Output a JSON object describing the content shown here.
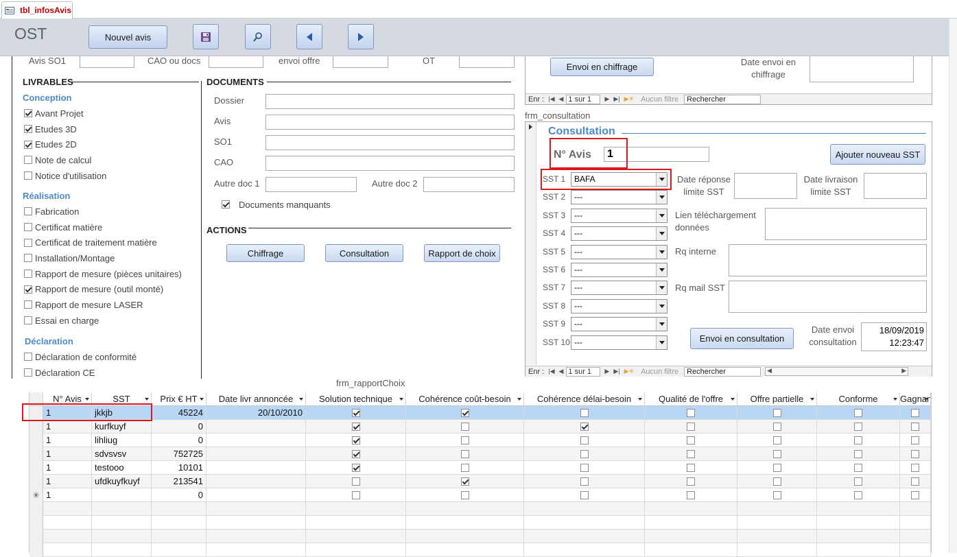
{
  "tab": {
    "label": "tbl_infosAvis"
  },
  "header": {
    "title": "OST",
    "new_button": "Nouvel avis"
  },
  "top_partial": {
    "labels": [
      "Avis SO1",
      "CAO ou docs",
      "envoi offre",
      "OT"
    ]
  },
  "livrables": {
    "title": "LIVRABLES",
    "conception": {
      "title": "Conception",
      "items": [
        {
          "label": "Avant Projet",
          "checked": true
        },
        {
          "label": "Etudes 3D",
          "checked": true
        },
        {
          "label": "Etudes 2D",
          "checked": true
        },
        {
          "label": "Note de calcul",
          "checked": false
        },
        {
          "label": "Notice d'utilisation",
          "checked": false
        }
      ]
    },
    "realisation": {
      "title": "Réalisation",
      "items": [
        {
          "label": "Fabrication",
          "checked": false
        },
        {
          "label": "Certificat matière",
          "checked": false
        },
        {
          "label": "Certificat de traitement matière",
          "checked": false
        },
        {
          "label": "Installation/Montage",
          "checked": false
        },
        {
          "label": "Rapport de mesure (pièces unitaires)",
          "checked": false
        },
        {
          "label": "Rapport de mesure (outil monté)",
          "checked": true
        },
        {
          "label": "Rapport de mesure LASER",
          "checked": false
        },
        {
          "label": "Essai en charge",
          "checked": false
        }
      ]
    },
    "declaration": {
      "title": "Déclaration",
      "items": [
        {
          "label": "Déclaration de conformité",
          "checked": false
        },
        {
          "label": "Déclaration CE",
          "checked": false
        }
      ]
    }
  },
  "documents": {
    "title": "DOCUMENTS",
    "fields": [
      "Dossier",
      "Avis",
      "SO1",
      "CAO"
    ],
    "autre1": "Autre doc 1",
    "autre2": "Autre doc 2",
    "manquants": {
      "label": "Documents manquants",
      "checked": true
    }
  },
  "actions": {
    "title": "ACTIONS",
    "buttons": [
      "Chiffrage",
      "Consultation",
      "Rapport de choix"
    ]
  },
  "chiffrage_sub": {
    "send_button": "Envoi en chiffrage",
    "date_label": "Date envoi en chiffrage",
    "nav": {
      "enr": "Enr :",
      "record": "1 sur 1",
      "filter": "Aucun filtre",
      "search": "Rechercher"
    }
  },
  "consultation": {
    "form_name": "frm_consultation",
    "title": "Consultation",
    "navis_label": "N° Avis",
    "navis_value": "1",
    "add_button": "Ajouter nouveau SST",
    "sst": [
      {
        "label": "SST 1",
        "value": "BAFA"
      },
      {
        "label": "SST 2",
        "value": "---"
      },
      {
        "label": "SST 3",
        "value": "---"
      },
      {
        "label": "SST 4",
        "value": "---"
      },
      {
        "label": "SST 5",
        "value": "---"
      },
      {
        "label": "SST 6",
        "value": "---"
      },
      {
        "label": "SST 7",
        "value": "---"
      },
      {
        "label": "SST 8",
        "value": "---"
      },
      {
        "label": "SST 9",
        "value": "---"
      },
      {
        "label": "SST 10",
        "value": "---"
      }
    ],
    "date_reponse_label": "Date réponse limite SST",
    "date_livraison_label": "Date livraison limite SST",
    "lien_label": "Lien téléchargement données",
    "rq_interne_label": "Rq interne",
    "rq_mail_label": "Rq mail SST",
    "send_button": "Envoi en consultation",
    "date_envoi_label": "Date envoi consultation",
    "date_envoi_date": "18/09/2019",
    "date_envoi_time": "12:23:47",
    "nav": {
      "enr": "Enr :",
      "record": "1 sur 1",
      "filter": "Aucun filtre",
      "search": "Rechercher"
    }
  },
  "rapport": {
    "form_name": "frm_rapportChoix",
    "columns": [
      "N° Avis",
      "SST",
      "Prix € HT",
      "Date livr annoncée",
      "Solution technique",
      "Cohérence coût-besoin",
      "Cohérence délai-besoin",
      "Qualité de l'offre",
      "Offre partielle",
      "Conforme",
      "Gagnant"
    ],
    "rows": [
      {
        "navis": "1",
        "sst": "jkkjb",
        "prix": "45224",
        "date": "20/10/2010",
        "checks": [
          true,
          true,
          false,
          false,
          false,
          false,
          false
        ]
      },
      {
        "navis": "1",
        "sst": "kurfkuyf",
        "prix": "0",
        "date": "",
        "checks": [
          true,
          false,
          true,
          false,
          false,
          false,
          false
        ]
      },
      {
        "navis": "1",
        "sst": "lihliug",
        "prix": "0",
        "date": "",
        "checks": [
          true,
          false,
          false,
          false,
          false,
          false,
          false
        ]
      },
      {
        "navis": "1",
        "sst": "sdvsvsv",
        "prix": "752725",
        "date": "",
        "checks": [
          true,
          false,
          false,
          false,
          false,
          false,
          false
        ]
      },
      {
        "navis": "1",
        "sst": "testooo",
        "prix": "10101",
        "date": "",
        "checks": [
          true,
          false,
          false,
          false,
          false,
          false,
          false
        ]
      },
      {
        "navis": "1",
        "sst": "ufdkuyfkuyf",
        "prix": "213541",
        "date": "",
        "checks": [
          false,
          true,
          false,
          false,
          false,
          false,
          false
        ]
      }
    ],
    "new_row": {
      "marker": "✳",
      "navis": "1",
      "prix": "0"
    },
    "selected_row_color": "#b9d7f4"
  }
}
